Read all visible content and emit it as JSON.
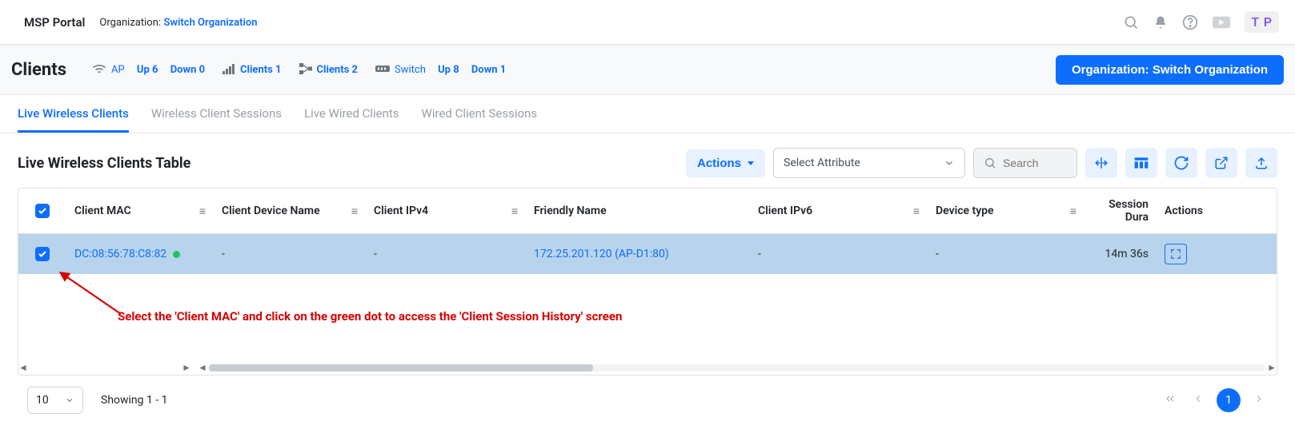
{
  "header": {
    "portal": "MSP Portal",
    "org_label": "Organization:",
    "org_link": "Switch Organization",
    "avatar": "T P"
  },
  "second": {
    "title": "Clients",
    "ap_label": "AP",
    "ap_up": "Up 6",
    "ap_down": "Down 0",
    "clients1": "Clients 1",
    "clients2": "Clients 2",
    "switch_label": "Switch",
    "switch_up": "Up 8",
    "switch_down": "Down 1",
    "button": "Organization: Switch Organization"
  },
  "tabs": [
    {
      "label": "Live Wireless Clients",
      "active": true
    },
    {
      "label": "Wireless Client Sessions"
    },
    {
      "label": "Live Wired Clients"
    },
    {
      "label": "Wired Client Sessions"
    }
  ],
  "tableTitle": "Live Wireless Clients Table",
  "toolbar": {
    "actions": "Actions",
    "select_attr": "Select Attribute",
    "search": "Search"
  },
  "columns": {
    "mac": "Client MAC",
    "devname": "Client Device Name",
    "ipv4": "Client IPv4",
    "friend": "Friendly Name",
    "ipv6": "Client IPv6",
    "devtype": "Device type",
    "session": "Session Dura",
    "actions": "Actions"
  },
  "row": {
    "mac": "DC:08:56:78:C8:82",
    "devname": "-",
    "ipv4": "-",
    "friend": "172.25.201.120 (AP-D1:80)",
    "ipv6": "-",
    "devtype": "-",
    "session": "14m 36s"
  },
  "annotation": "Select the 'Client MAC' and click on the green dot to access the 'Client Session History' screen",
  "footer": {
    "page_size": "10",
    "showing": "Showing 1 - 1",
    "current_page": "1"
  }
}
